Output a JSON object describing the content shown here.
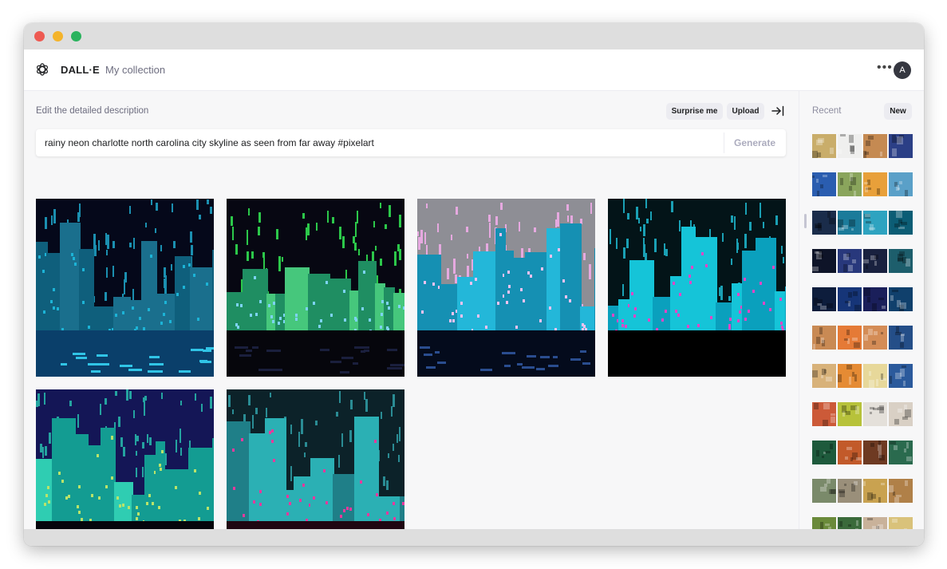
{
  "window": {
    "controls": [
      "close",
      "minimize",
      "maximize"
    ]
  },
  "appbar": {
    "logo_icon": "openai-logo-icon",
    "brand": "DALL·E",
    "nav_link": "My collection",
    "more_icon": "•••",
    "avatar_initial": "A"
  },
  "editor": {
    "hint": "Edit the detailed description",
    "surprise_label": "Surprise me",
    "upload_label": "Upload",
    "collapse_icon": "collapse-sidebar-icon",
    "prompt_value": "rainy neon charlotte north carolina city skyline as seen from far away #pixelart",
    "generate_label": "Generate"
  },
  "results": {
    "images": [
      {
        "sky": "#05081a",
        "rain": "#1b8fb0",
        "b1": "#0f5f7c",
        "b2": "#1a6f8d",
        "accent": "#1cb3d6",
        "ground": "#0a3f6a",
        "water": "#30c4e6"
      },
      {
        "sky": "#070712",
        "rain": "#2cc84a",
        "b1": "#1f8e62",
        "b2": "#46c77c",
        "accent": "#7dd3f5",
        "ground": "#06060c",
        "water": "#1a1f3d"
      },
      {
        "sky": "#8e8e95",
        "rain": "#e6a9e0",
        "b1": "#23b7d9",
        "b2": "#1590b3",
        "accent": "#f0c2ee",
        "ground": "#040b1c",
        "water": "#2a4d8f"
      },
      {
        "sky": "#031418",
        "rain": "#1aa0b4",
        "b1": "#15c4d8",
        "b2": "#0aa0bd",
        "accent": "#e246c6",
        "ground": "#000000",
        "water": "#000000"
      },
      {
        "sky": "#141656",
        "rain": "#24a3a0",
        "b1": "#2fcdb2",
        "b2": "#139c92",
        "accent": "#b9e36a",
        "ground": "#05050c",
        "water": "#3a1e8f"
      },
      {
        "sky": "#0c2229",
        "rain": "#2a8c94",
        "b1": "#1f7f88",
        "b2": "#2bb0b4",
        "accent": "#e8399d",
        "ground": "#1f0612",
        "water": "#1f0612"
      }
    ]
  },
  "recent": {
    "label": "Recent",
    "new_label": "New",
    "rows": [
      [
        "#c9ad6a",
        "#efefee",
        "#c58a52",
        "#2b3f86"
      ],
      [
        "#2a5db0",
        "#8aa55c",
        "#e8a03a",
        "#5aa0c8"
      ],
      [
        "#1a2c4a",
        "#1b7b9a",
        "#2ea3c0",
        "#0c5d75"
      ],
      [
        "#0e1428",
        "#28387c",
        "#19213f",
        "#1d5e6c"
      ],
      [
        "#0d1d3c",
        "#163578",
        "#1a1f5a",
        "#10406c"
      ],
      [
        "#c98a54",
        "#e57a36",
        "#d48c56",
        "#244e88"
      ],
      [
        "#d8b27a",
        "#e58b34",
        "#e7d89a",
        "#2b5a9c"
      ],
      [
        "#cc5a38",
        "#b7c23a",
        "#e4e0da",
        "#d9d0c5"
      ],
      [
        "#1e5a3c",
        "#c25a2a",
        "#6e3a22",
        "#2a6a4e"
      ],
      [
        "#7a8a6a",
        "#9a8f7a",
        "#c9a250",
        "#b08048"
      ],
      [
        "#6a8a3a",
        "#3a6a3a",
        "#c9b29a",
        "#d9c27a"
      ]
    ]
  }
}
